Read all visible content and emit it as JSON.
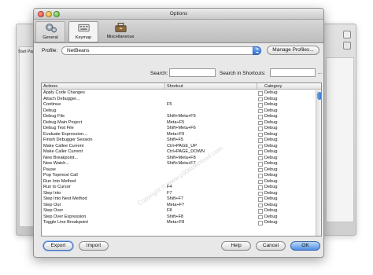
{
  "window": {
    "title": "Options"
  },
  "background_window": {
    "tab_label": "Start Pag"
  },
  "toolbar": {
    "categories": [
      {
        "label": "General",
        "icon": "gear-icon"
      },
      {
        "label": "Keymap",
        "icon": "keyboard-icon"
      },
      {
        "label": "Miscellaneous",
        "icon": "toolbox-icon"
      }
    ]
  },
  "profile": {
    "label": "Profile:",
    "value": "NetBeans",
    "manage_label": "Manage Profiles..."
  },
  "search": {
    "label": "Search:",
    "value": "",
    "shortcuts_label": "Search in Shortcuts:",
    "shortcuts_value": "",
    "more": "..."
  },
  "table": {
    "headers": {
      "actions": "Actions",
      "shortcut": "Shortcut",
      "category": "Category"
    },
    "rows": [
      {
        "action": "Apply Code Changes",
        "shortcut": "",
        "category": "Debug"
      },
      {
        "action": "Attach Debugger...",
        "shortcut": "",
        "category": "Debug"
      },
      {
        "action": "Continue",
        "shortcut": "F5",
        "category": "Debug"
      },
      {
        "action": "Debug",
        "shortcut": "",
        "category": "Debug"
      },
      {
        "action": "Debug File",
        "shortcut": "Shift+Meta+F5",
        "category": "Debug"
      },
      {
        "action": "Debug Main Project",
        "shortcut": "Meta+F5",
        "category": "Debug"
      },
      {
        "action": "Debug Test File",
        "shortcut": "Shift+Meta+F6",
        "category": "Debug"
      },
      {
        "action": "Evaluate Expression...",
        "shortcut": "Meta+F9",
        "category": "Debug"
      },
      {
        "action": "Finish Debugger Session",
        "shortcut": "Shift+F5",
        "category": "Debug"
      },
      {
        "action": "Make Callee Current",
        "shortcut": "Ctrl+PAGE_UP",
        "category": "Debug"
      },
      {
        "action": "Make Caller Current",
        "shortcut": "Ctrl+PAGE_DOWN",
        "category": "Debug"
      },
      {
        "action": "New Breakpoint...",
        "shortcut": "Shift+Meta+F8",
        "category": "Debug"
      },
      {
        "action": "New Watch...",
        "shortcut": "Shift+Meta+F7",
        "category": "Debug"
      },
      {
        "action": "Pause",
        "shortcut": "",
        "category": "Debug"
      },
      {
        "action": "Pop Topmost Call",
        "shortcut": "",
        "category": "Debug"
      },
      {
        "action": "Run Into Method",
        "shortcut": "",
        "category": "Debug"
      },
      {
        "action": "Run to Cursor",
        "shortcut": "F4",
        "category": "Debug"
      },
      {
        "action": "Step Into",
        "shortcut": "F7",
        "category": "Debug"
      },
      {
        "action": "Step Into Next Method",
        "shortcut": "Shift+F7",
        "category": "Debug"
      },
      {
        "action": "Step Out",
        "shortcut": "Meta+F7",
        "category": "Debug"
      },
      {
        "action": "Step Over",
        "shortcut": "F8",
        "category": "Debug"
      },
      {
        "action": "Step Over Expression",
        "shortcut": "Shift+F8",
        "category": "Debug"
      },
      {
        "action": "Toggle Line Breakpoint",
        "shortcut": "Meta+F8",
        "category": "Debug"
      }
    ]
  },
  "watermark": "Copyright © www.p30download.com",
  "buttons": {
    "export": "Export",
    "import": "Import",
    "help": "Help",
    "cancel": "Cancel",
    "ok": "OK"
  }
}
